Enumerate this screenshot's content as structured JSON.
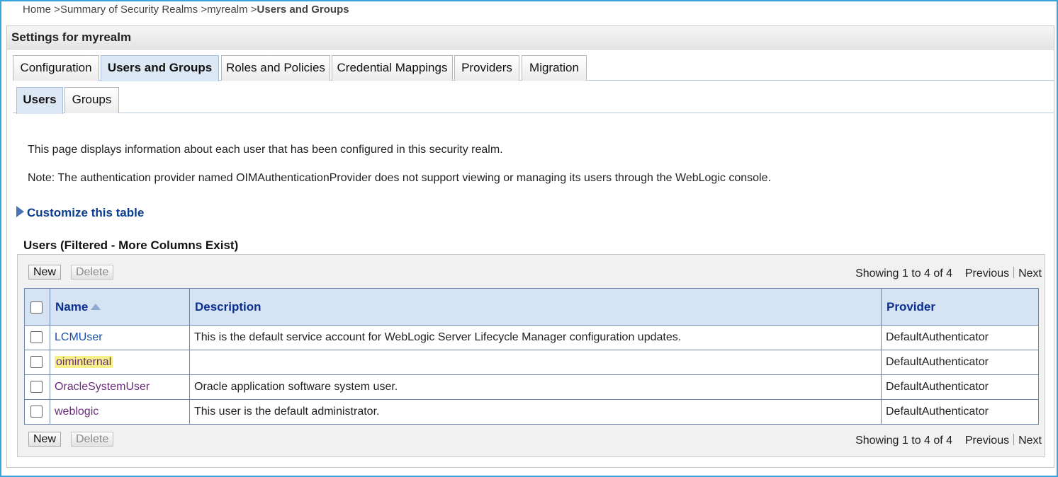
{
  "breadcrumb": {
    "home": "Home >",
    "realms": "Summary of Security Realms >",
    "realm": "myrealm >",
    "current": "Users and Groups"
  },
  "panel_title": "Settings for myrealm",
  "tabs": [
    {
      "label": "Configuration"
    },
    {
      "label": "Users and Groups",
      "active": true
    },
    {
      "label": "Roles and Policies"
    },
    {
      "label": "Credential Mappings"
    },
    {
      "label": "Providers"
    },
    {
      "label": "Migration"
    }
  ],
  "subtabs": [
    {
      "label": "Users",
      "active": true
    },
    {
      "label": "Groups"
    }
  ],
  "intro": {
    "line1": "This page displays information about each user that has been configured in this security realm.",
    "line2": "Note: The authentication provider named OIMAuthenticationProvider does not support viewing or managing its users through the WebLogic console."
  },
  "customize_label": "Customize this table",
  "table": {
    "title": "Users (Filtered - More Columns Exist)",
    "new_label": "New",
    "delete_label": "Delete",
    "showing": "Showing 1 to 4 of 4",
    "previous": "Previous",
    "next": "Next",
    "columns": {
      "name": "Name",
      "description": "Description",
      "provider": "Provider"
    },
    "rows": [
      {
        "name": "LCMUser",
        "description": "This is the default service account for WebLogic Server Lifecycle Manager configuration updates.",
        "provider": "DefaultAuthenticator"
      },
      {
        "name": "oiminternal",
        "description": "",
        "provider": "DefaultAuthenticator",
        "highlight_color": "#f5f08a"
      },
      {
        "name": "OracleSystemUser",
        "description": "Oracle application software system user.",
        "provider": "DefaultAuthenticator"
      },
      {
        "name": "weblogic",
        "description": "This user is the default administrator.",
        "provider": "DefaultAuthenticator"
      }
    ]
  },
  "colors": {
    "accent_border": "#39a3e0",
    "header_bg": "#d6e3f3",
    "header_text": "#0a2f8c",
    "link": "#1a4ea8",
    "visited_link": "#6a2c7c"
  }
}
